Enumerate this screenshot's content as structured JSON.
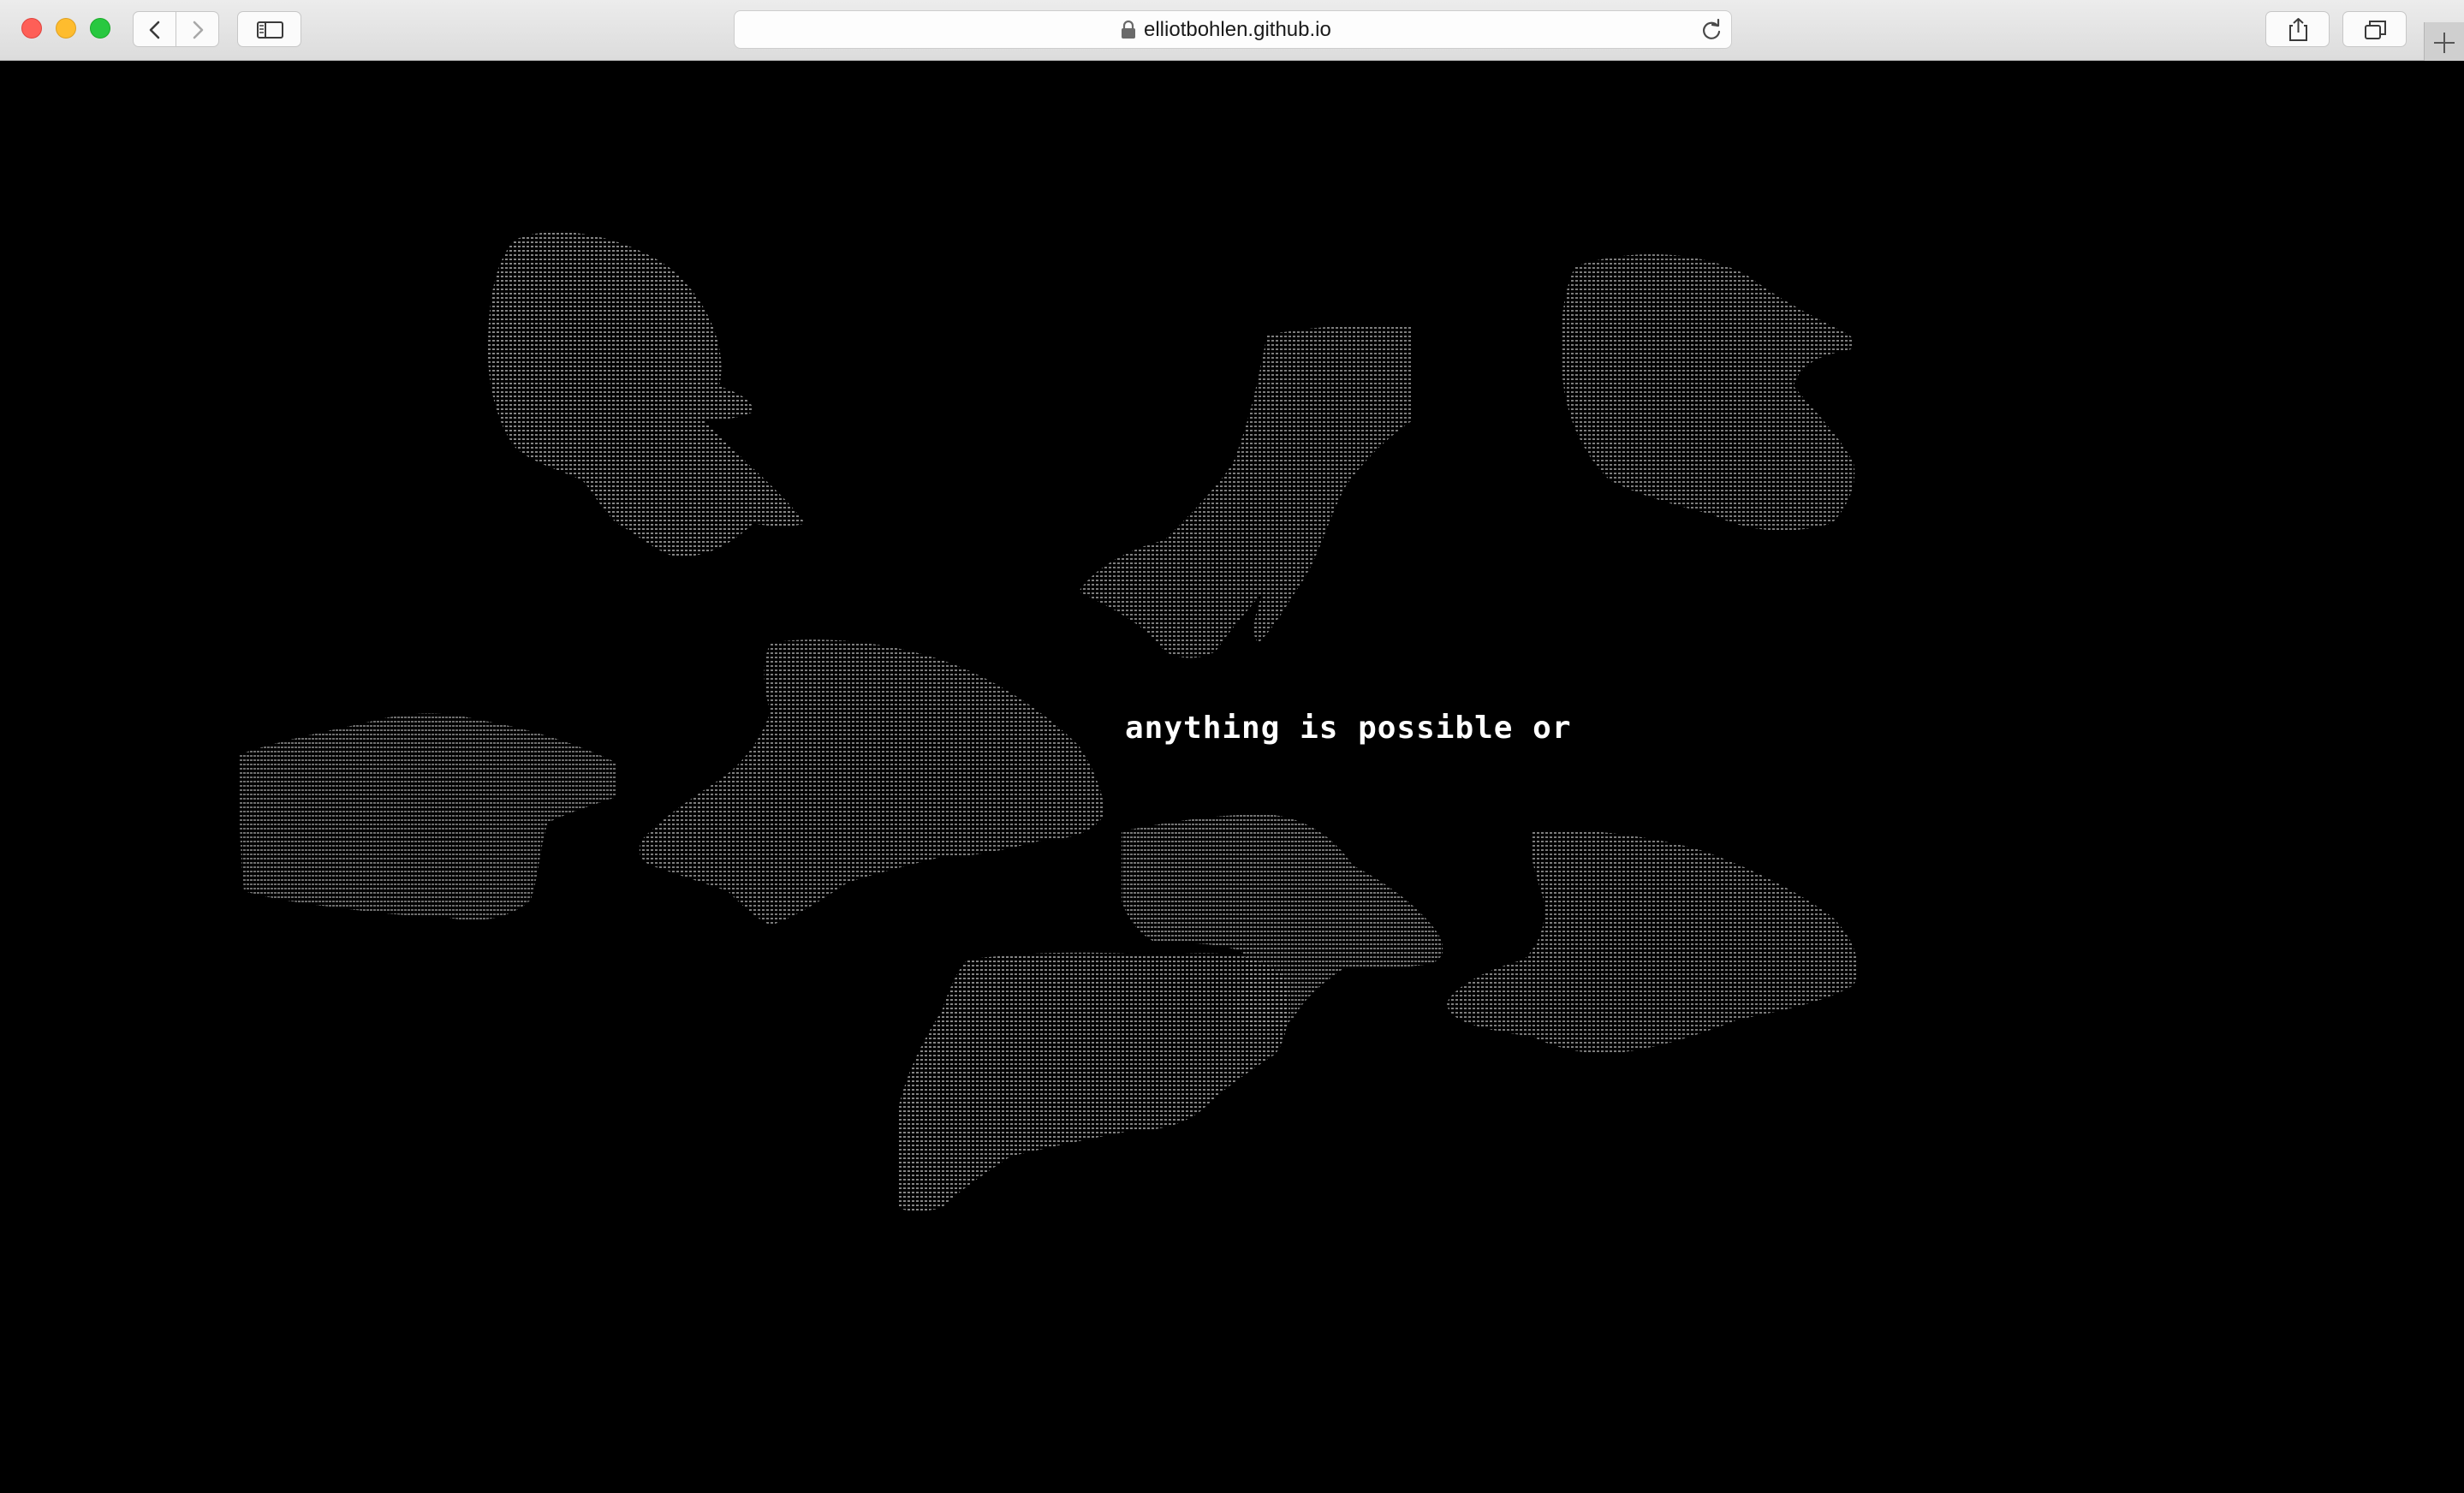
{
  "browser": {
    "url": "elliotbohlen.github.io",
    "secure": true,
    "icons": {
      "back": "chevron-left-icon",
      "forward": "chevron-right-icon",
      "sidebar": "sidebar-icon",
      "lock": "lock-icon",
      "reload": "reload-icon",
      "share": "share-icon",
      "tabs": "tabs-overview-icon",
      "new_tab": "plus-icon"
    }
  },
  "page": {
    "background": "#000000",
    "text": "anything is possible or",
    "text_color": "#ffffff",
    "ascii_color": "#9a9a9a",
    "art_description_icon": "ascii-hand-icon"
  }
}
